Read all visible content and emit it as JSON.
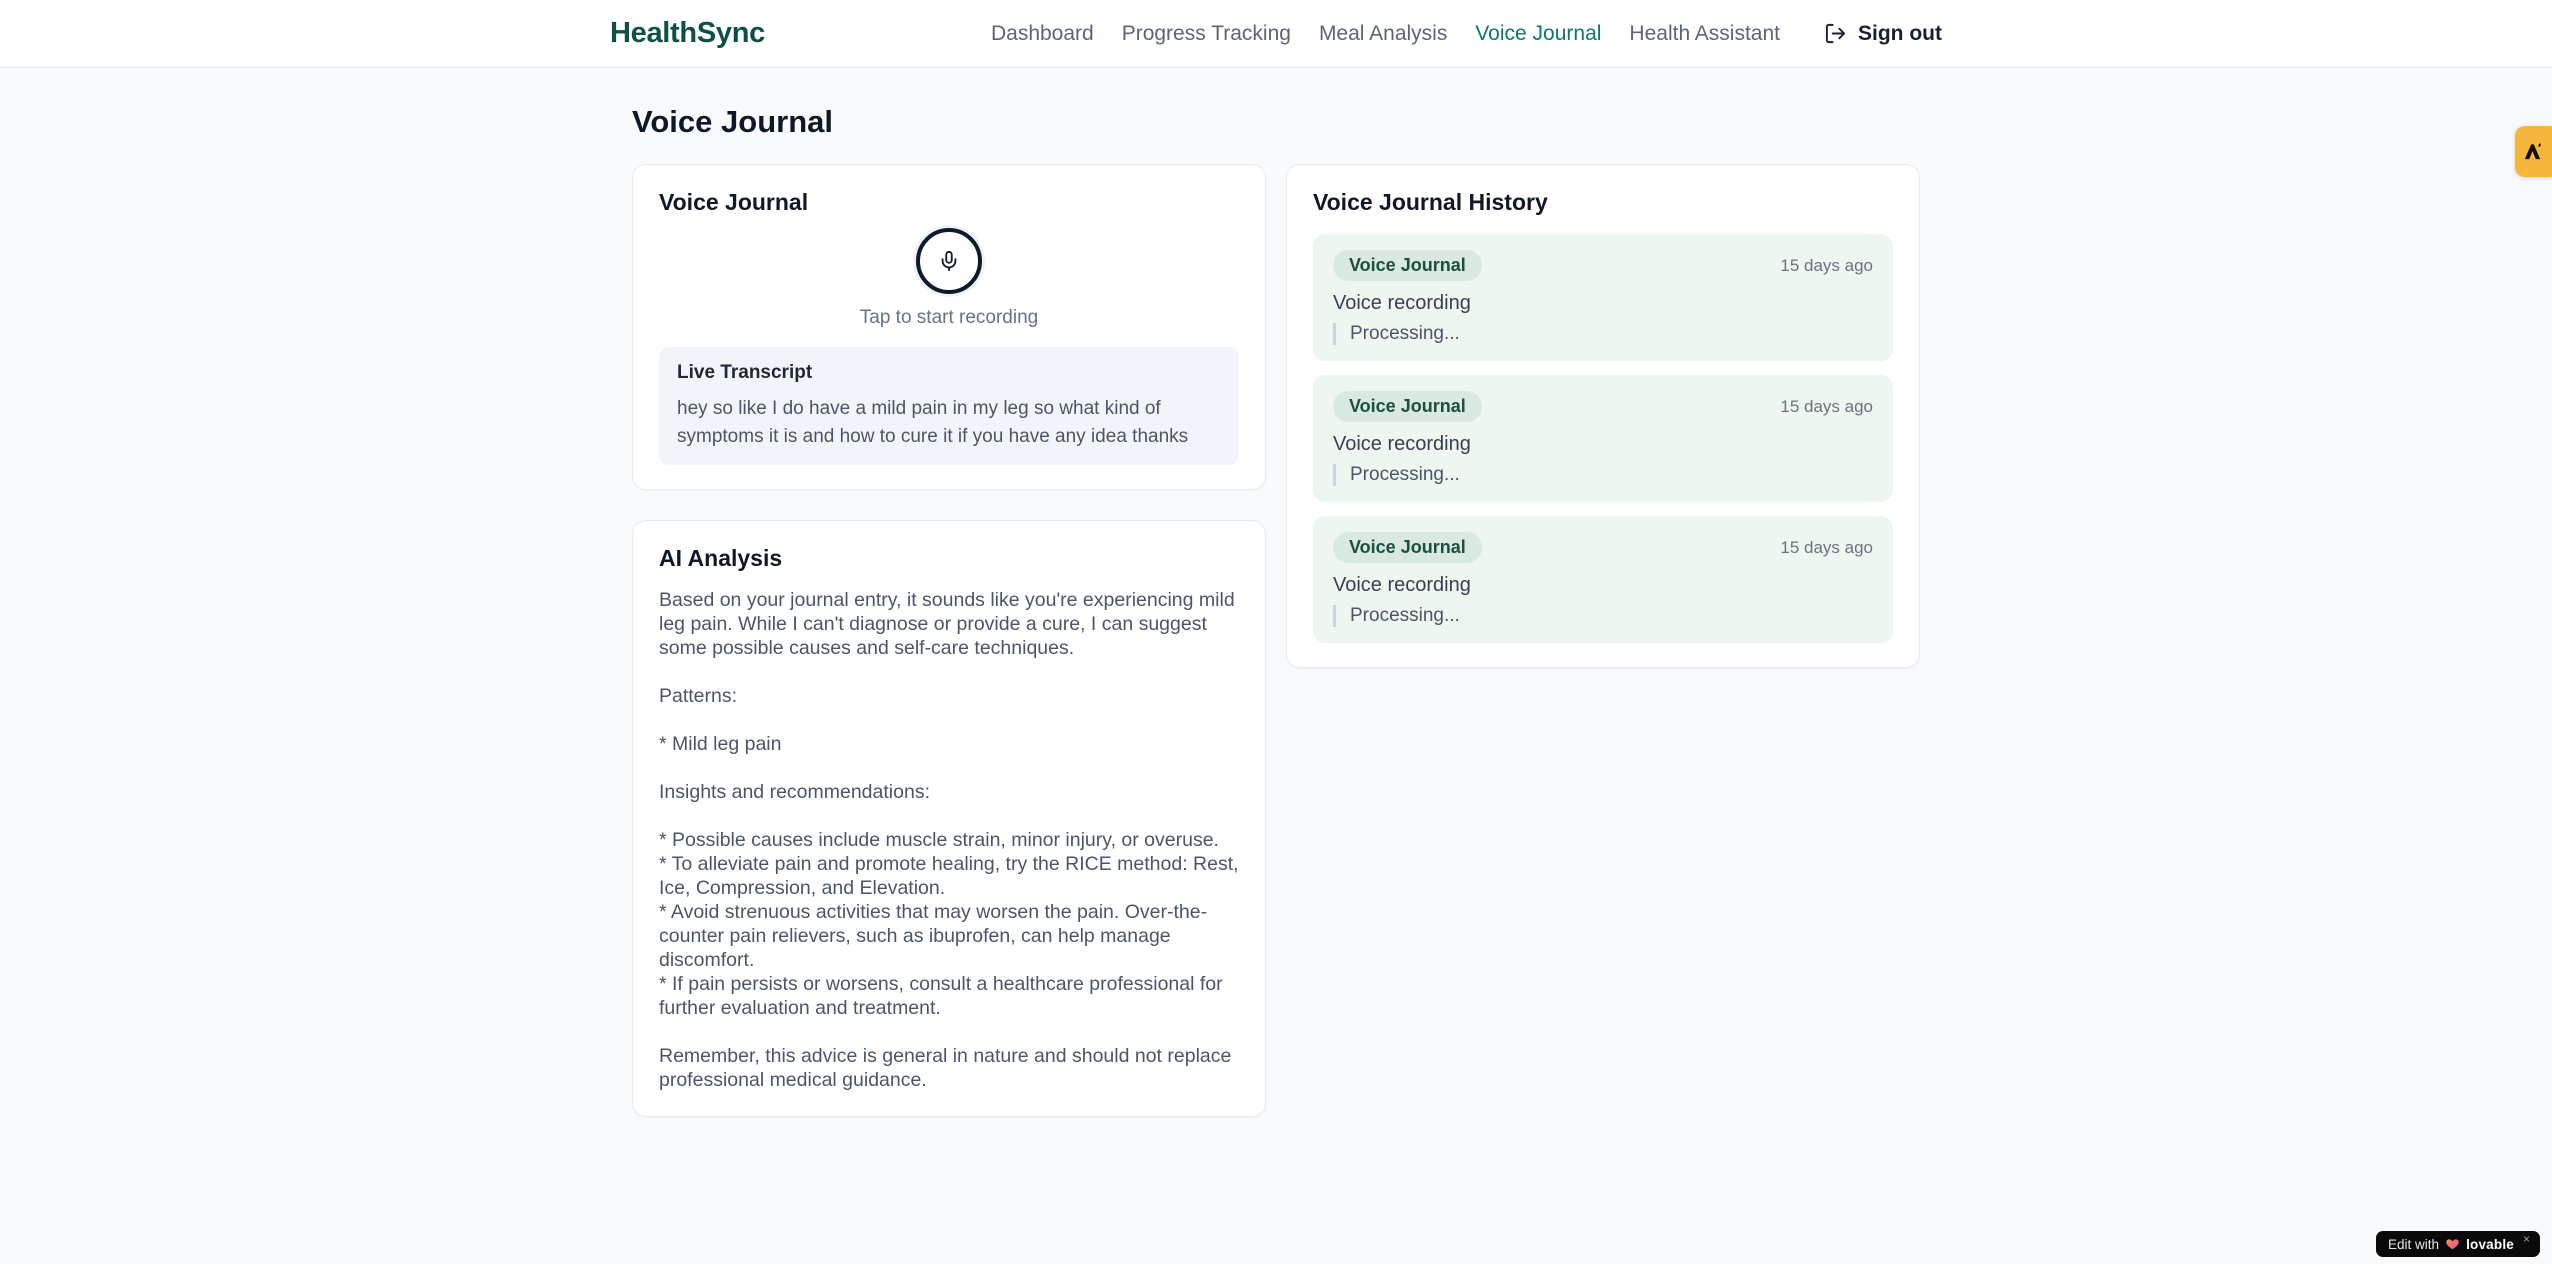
{
  "brand": "HealthSync",
  "nav": {
    "items": [
      {
        "label": "Dashboard"
      },
      {
        "label": "Progress Tracking"
      },
      {
        "label": "Meal Analysis"
      },
      {
        "label": "Voice Journal",
        "active": true
      },
      {
        "label": "Health Assistant"
      }
    ],
    "sign_out_label": "Sign out"
  },
  "page": {
    "title": "Voice Journal"
  },
  "recorder_card": {
    "title": "Voice Journal",
    "mic_icon": "microphone-icon",
    "tap_hint": "Tap to start recording",
    "transcript": {
      "title": "Live Transcript",
      "text": "hey so like I do have a mild pain in my leg so what kind of symptoms it is and how to cure it if you have any idea thanks"
    }
  },
  "analysis_card": {
    "title": "AI Analysis",
    "body": "Based on your journal entry, it sounds like you're experiencing mild leg pain. While I can't diagnose or provide a cure, I can suggest some possible causes and self-care techniques.\n\nPatterns:\n\n* Mild leg pain\n\nInsights and recommendations:\n\n* Possible causes include muscle strain, minor injury, or overuse.\n* To alleviate pain and promote healing, try the RICE method: Rest, Ice, Compression, and Elevation.\n* Avoid strenuous activities that may worsen the pain. Over-the-counter pain relievers, such as ibuprofen, can help manage discomfort.\n* If pain persists or worsens, consult a healthcare professional for further evaluation and treatment.\n\nRemember, this advice is general in nature and should not replace professional medical guidance."
  },
  "history_card": {
    "title": "Voice Journal History",
    "items": [
      {
        "badge": "Voice Journal",
        "time": "15 days ago",
        "label": "Voice recording",
        "status": "Processing..."
      },
      {
        "badge": "Voice Journal",
        "time": "15 days ago",
        "label": "Voice recording",
        "status": "Processing..."
      },
      {
        "badge": "Voice Journal",
        "time": "15 days ago",
        "label": "Voice recording",
        "status": "Processing..."
      }
    ]
  },
  "overlays": {
    "edit_badge": {
      "prefix": "Edit with",
      "brand": "lovable",
      "heart_icon": "heart-icon",
      "close": "×"
    },
    "side_tab": {
      "icon": "lovable-logo-icon"
    }
  },
  "colors": {
    "brand_teal": "#0d5045",
    "nav_active_teal": "#0f766e",
    "page_background": "#f8fafc",
    "badge_background": "#d9e9df",
    "badge_text": "#1c4e41",
    "history_item_background": "#eef6f0",
    "transcript_background": "#f1f5f9",
    "side_tab_orange": "#f6b63d",
    "edit_badge_black": "#0a0a0a"
  }
}
